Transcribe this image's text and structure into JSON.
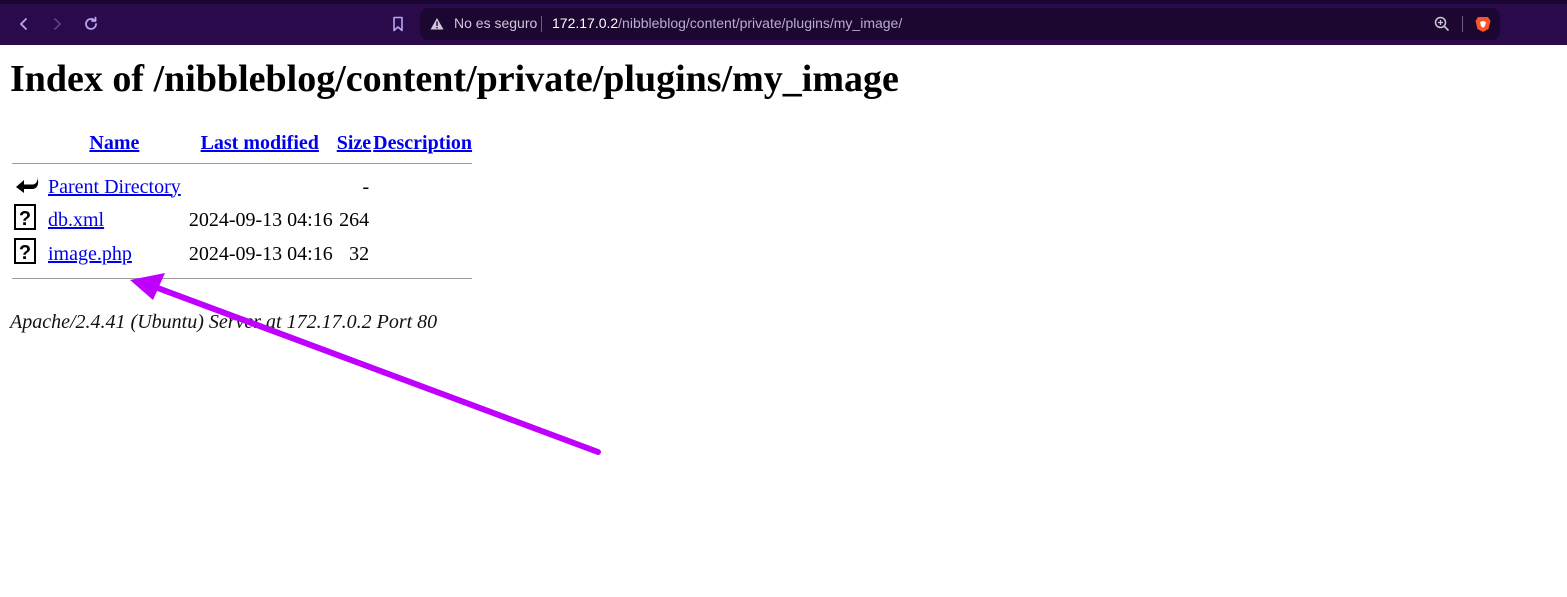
{
  "browser": {
    "security_label": "No es seguro",
    "url_host": "172.17.0.2",
    "url_path": "/nibbleblog/content/private/plugins/my_image/",
    "accent_color": "#2a0a4a"
  },
  "page": {
    "title": "Index of /nibbleblog/content/private/plugins/my_image",
    "columns": {
      "name": "Name",
      "modified": "Last modified",
      "size": "Size",
      "description": "Description"
    },
    "rows": [
      {
        "icon": "back-arrow-icon",
        "name": "Parent Directory",
        "modified": "",
        "size": "-",
        "description": ""
      },
      {
        "icon": "unknown-file-icon",
        "name": "db.xml",
        "modified": "2024-09-13 04:16",
        "size": "264",
        "description": ""
      },
      {
        "icon": "unknown-file-icon",
        "name": "image.php",
        "modified": "2024-09-13 04:16",
        "size": "32",
        "description": ""
      }
    ],
    "footer": "Apache/2.4.41 (Ubuntu) Server at 172.17.0.2 Port 80"
  },
  "annotation": {
    "arrow_color": "#c000ff"
  }
}
